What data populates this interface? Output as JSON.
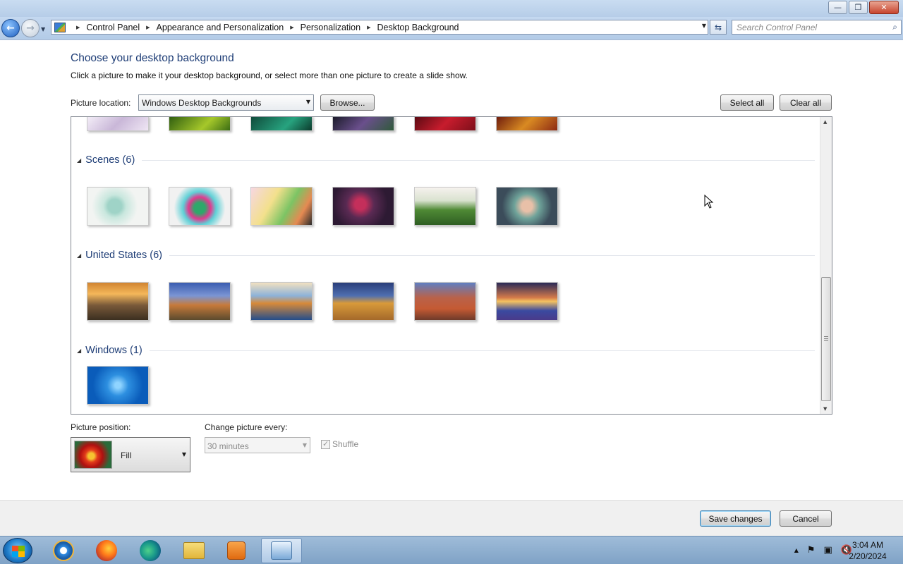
{
  "window": {
    "minimize": "—",
    "maximize": "❐",
    "close": "✕"
  },
  "nav": {
    "breadcrumbs": [
      "Control Panel",
      "Appearance and Personalization",
      "Personalization",
      "Desktop Background"
    ],
    "search_placeholder": "Search Control Panel"
  },
  "content": {
    "title": "Choose your desktop background",
    "instruction": "Click a picture to make it your desktop background, or select more than one picture to create a slide show.",
    "picture_location_label": "Picture location:",
    "picture_location_value": "Windows Desktop Backgrounds",
    "browse_label": "Browse...",
    "select_all_label": "Select all",
    "clear_all_label": "Clear all",
    "groups": [
      {
        "name": "Scenes (6)",
        "count": 6
      },
      {
        "name": "United States (6)",
        "count": 6
      },
      {
        "name": "Windows (1)",
        "count": 1
      }
    ]
  },
  "options": {
    "picture_position_label": "Picture position:",
    "picture_position_value": "Fill",
    "change_every_label": "Change picture every:",
    "change_every_value": "30 minutes",
    "shuffle_label": "Shuffle",
    "shuffle_checked": true,
    "shuffle_enabled": false
  },
  "footer": {
    "save_label": "Save changes",
    "cancel_label": "Cancel"
  },
  "taskbar": {
    "time": "3:04 AM",
    "date": "2/20/2024",
    "pinned": [
      "internet-explorer-icon",
      "firefox-icon",
      "edge-icon",
      "file-explorer-icon",
      "media-player-icon",
      "control-panel-icon"
    ]
  }
}
